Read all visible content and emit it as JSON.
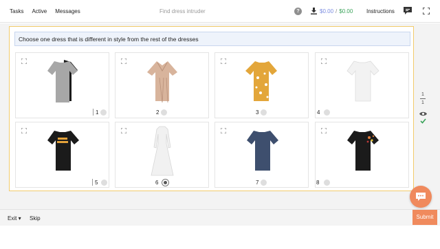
{
  "nav": {
    "tasks": "Tasks",
    "active": "Active",
    "messages": "Messages"
  },
  "task_title": "Find dress intruder",
  "earnings": {
    "pending": "$0.00",
    "separator": "/",
    "approved": "$0.00"
  },
  "instructions_label": "Instructions",
  "prompt": "Choose one dress that is different in style from the rest of the dresses",
  "items": [
    {
      "label": "1",
      "selected": false,
      "dress": "grey-tshirt-dress-with-black"
    },
    {
      "label": "2",
      "selected": false,
      "dress": "beige-pleated-wrap-dress"
    },
    {
      "label": "3",
      "selected": false,
      "dress": "mustard-floral-dress"
    },
    {
      "label": "4",
      "selected": false,
      "dress": "white-tshirt-dress"
    },
    {
      "label": "5",
      "selected": false,
      "dress": "black-graphic-tshirt-dress"
    },
    {
      "label": "6",
      "selected": true,
      "dress": "white-long-sleeve-maxi-dress"
    },
    {
      "label": "7",
      "selected": false,
      "dress": "navy-tshirt-dress"
    },
    {
      "label": "8",
      "selected": false,
      "dress": "black-embroidered-tshirt-dress"
    }
  ],
  "page_counter": {
    "current": "1",
    "total": "1"
  },
  "bottom": {
    "exit": "Exit",
    "skip": "Skip",
    "submit": "Submit"
  },
  "colors": {
    "accent": "#f08a5d",
    "frame": "#f2cb6a",
    "approved": "#3aa35a",
    "pending": "#7a8be0"
  }
}
